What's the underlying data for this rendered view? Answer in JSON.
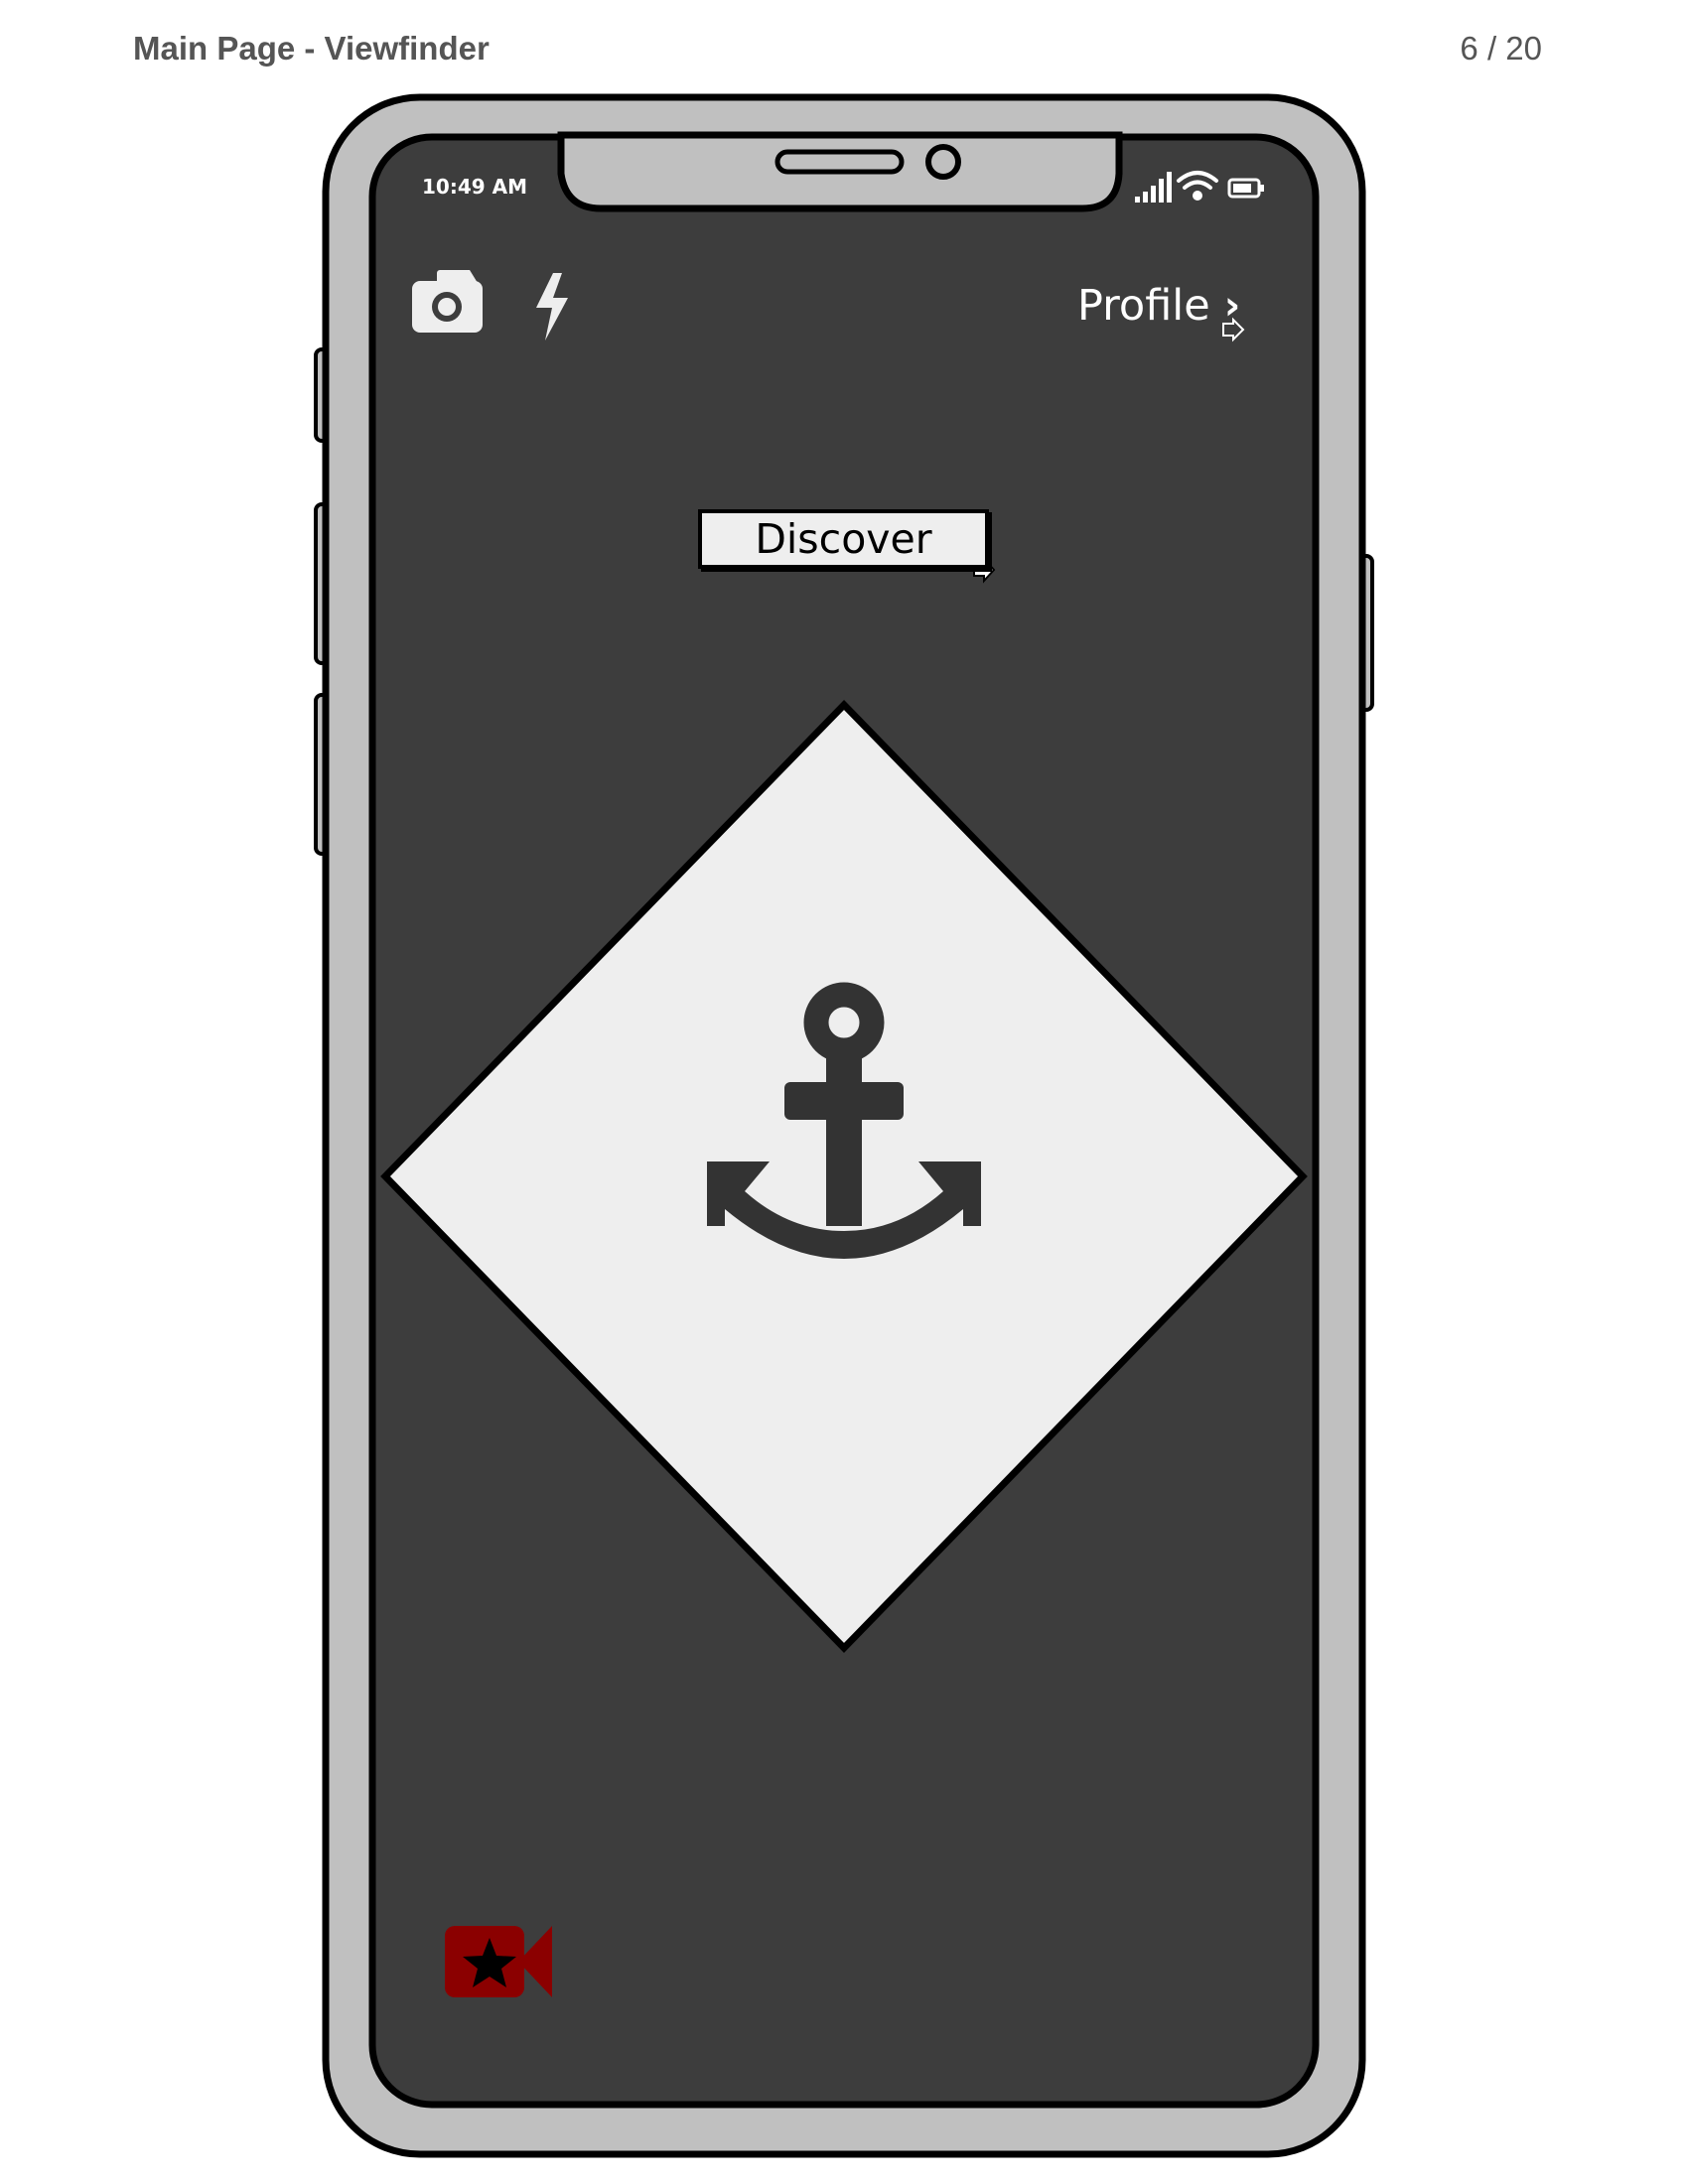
{
  "header": {
    "title": "Main Page - Viewfinder",
    "page_counter": "6 / 20"
  },
  "status_bar": {
    "time": "10:49 AM",
    "icons": [
      "signal-icon",
      "wifi-icon",
      "battery-icon"
    ]
  },
  "toolbar": {
    "camera_icon": "camera-icon",
    "flash_icon": "flash-icon",
    "profile_label": "Profile",
    "profile_chevron": "›"
  },
  "main": {
    "discover_label": "Discover",
    "center_icon": "anchor-icon"
  },
  "footer": {
    "record_icon": "video-star-icon"
  },
  "colors": {
    "screen": "#3d3d3d",
    "frame": "#c0c0c0",
    "diamond": "#eeeeee",
    "anchor": "#333333",
    "record": "#8b0000"
  }
}
